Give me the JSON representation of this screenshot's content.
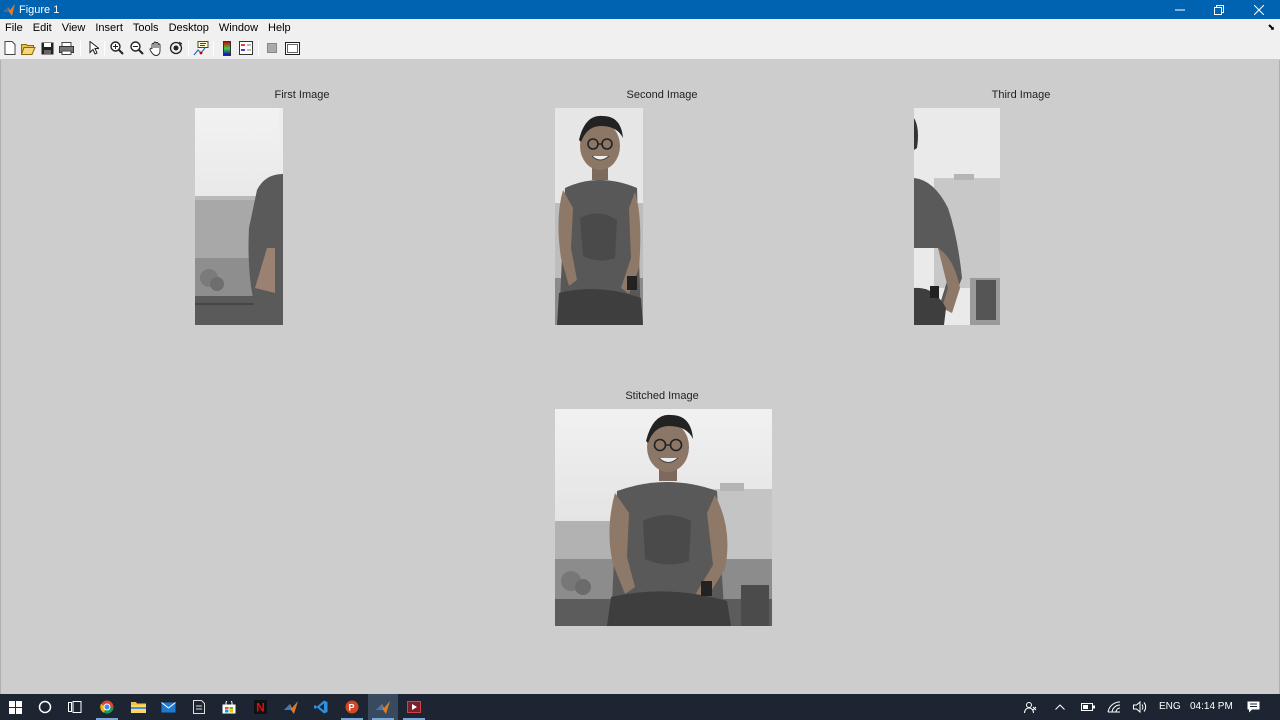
{
  "window": {
    "title": "Figure 1",
    "controls": [
      "minimize",
      "restore",
      "close"
    ]
  },
  "menubar": {
    "items": [
      "File",
      "Edit",
      "View",
      "Insert",
      "Tools",
      "Desktop",
      "Window",
      "Help"
    ]
  },
  "toolbar": {
    "icons": [
      "new-figure-icon",
      "open-icon",
      "save-icon",
      "print-icon",
      "select-pointer-icon",
      "zoom-in-icon",
      "zoom-out-icon",
      "pan-hand-icon",
      "rotate-3d-icon",
      "data-cursor-icon",
      "colorbar-icon",
      "legend-icon",
      "hide-plot-tools-icon",
      "show-plot-tools-icon"
    ]
  },
  "figure": {
    "axes": [
      {
        "title": "First Image"
      },
      {
        "title": "Second Image"
      },
      {
        "title": "Third Image"
      },
      {
        "title": "Stitched Image"
      }
    ]
  },
  "taskbar": {
    "apps": [
      "start-icon",
      "cortana-icon",
      "task-view-icon",
      "chrome-icon",
      "file-explorer-icon",
      "mail-icon",
      "document-icon",
      "store-icon",
      "netflix-icon",
      "matlab-icon",
      "vscode-icon",
      "powerpoint-icon",
      "matlab-figure-icon",
      "media-player-icon"
    ],
    "tray": {
      "language": "ENG",
      "time": "04:14 PM"
    }
  }
}
